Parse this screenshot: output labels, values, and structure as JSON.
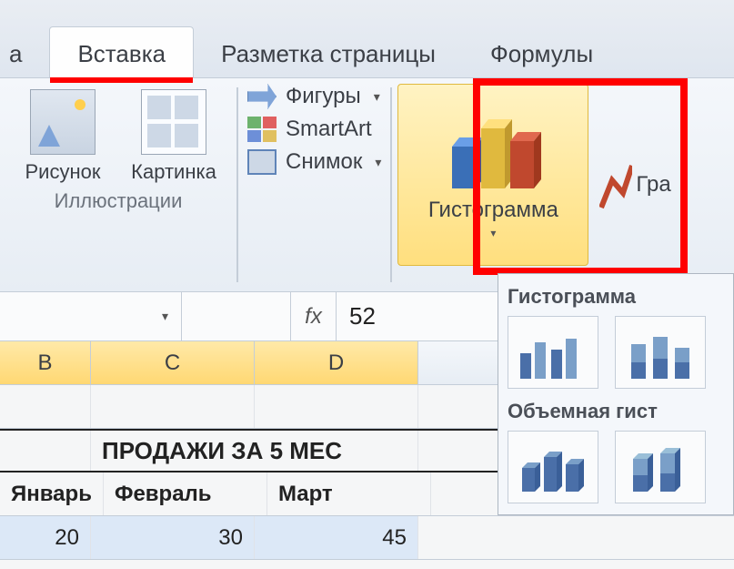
{
  "tabs": {
    "prev_partial": "а",
    "active": "Вставка",
    "layout": "Разметка страницы",
    "formulas": "Формулы"
  },
  "ribbon": {
    "illustrations": {
      "picture": "Рисунок",
      "clipart": "Картинка",
      "shapes": "Фигуры",
      "smartart": "SmartArt",
      "screenshot": "Снимок",
      "group_label": "Иллюстрации"
    },
    "charts": {
      "histogram": "Гистограмма",
      "next_partial": "Гра"
    }
  },
  "formula_bar": {
    "fx": "fx",
    "value": "52"
  },
  "columns": {
    "b": "B",
    "c": "C",
    "d": "D"
  },
  "sheet": {
    "title": "ПРОДАЖИ ЗА 5 МЕС",
    "headers": {
      "jan": "Январь",
      "feb": "Февраль",
      "mar": "Март"
    },
    "row1": {
      "jan": "20",
      "feb": "30",
      "mar": "45"
    }
  },
  "gallery": {
    "head1": "Гистограмма",
    "head2": "Объемная гист"
  }
}
